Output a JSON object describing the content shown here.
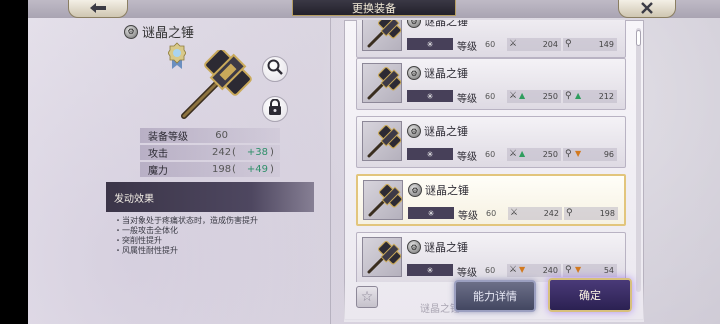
{
  "header": {
    "back_icon": "arrow-left-icon",
    "title": "更换装备",
    "close_icon": "close-x-icon"
  },
  "detail": {
    "name": "谜晶之锤",
    "stats": [
      {
        "label": "装备等级",
        "value": "60",
        "bonus": ""
      },
      {
        "label": "攻击",
        "value": "242",
        "bonus": "+38"
      },
      {
        "label": "魔力",
        "value": "198",
        "bonus": "+49"
      }
    ],
    "effect_title": "发动效果",
    "effects": [
      "当对象处于疼痛状态时，造成伤害提升",
      "一般攻击全体化",
      "突削性提升",
      "风属性耐性提升"
    ]
  },
  "list": {
    "cards": [
      {
        "name": "谜晶之锤",
        "skill": "✳",
        "lv_label": "等级",
        "lv": "60",
        "atk": "204",
        "atk_trend": "none",
        "mag": "149",
        "mag_trend": "none",
        "selected": false
      },
      {
        "name": "谜晶之锤",
        "skill": "✳",
        "lv_label": "等级",
        "lv": "60",
        "atk": "250",
        "atk_trend": "up",
        "mag": "212",
        "mag_trend": "up",
        "selected": false
      },
      {
        "name": "谜晶之锤",
        "skill": "✳",
        "lv_label": "等级",
        "lv": "60",
        "atk": "250",
        "atk_trend": "up",
        "mag": "96",
        "mag_trend": "down",
        "selected": false
      },
      {
        "name": "谜晶之锤",
        "skill": "✳",
        "lv_label": "等级",
        "lv": "60",
        "atk": "242",
        "atk_trend": "none",
        "mag": "198",
        "mag_trend": "none",
        "selected": true
      },
      {
        "name": "谜晶之锤",
        "skill": "✳",
        "lv_label": "等级",
        "lv": "60",
        "atk": "240",
        "atk_trend": "down",
        "mag": "54",
        "mag_trend": "down",
        "selected": false
      }
    ],
    "partial_name": "谜晶之锤"
  },
  "buttons": {
    "detail": "能力详情",
    "confirm": "确定"
  },
  "colors": {
    "accent_gold": "#e2c57c",
    "up_green": "#2f9d5e",
    "down_orange": "#d2791f",
    "bonus_green": "#2f8f6a"
  }
}
